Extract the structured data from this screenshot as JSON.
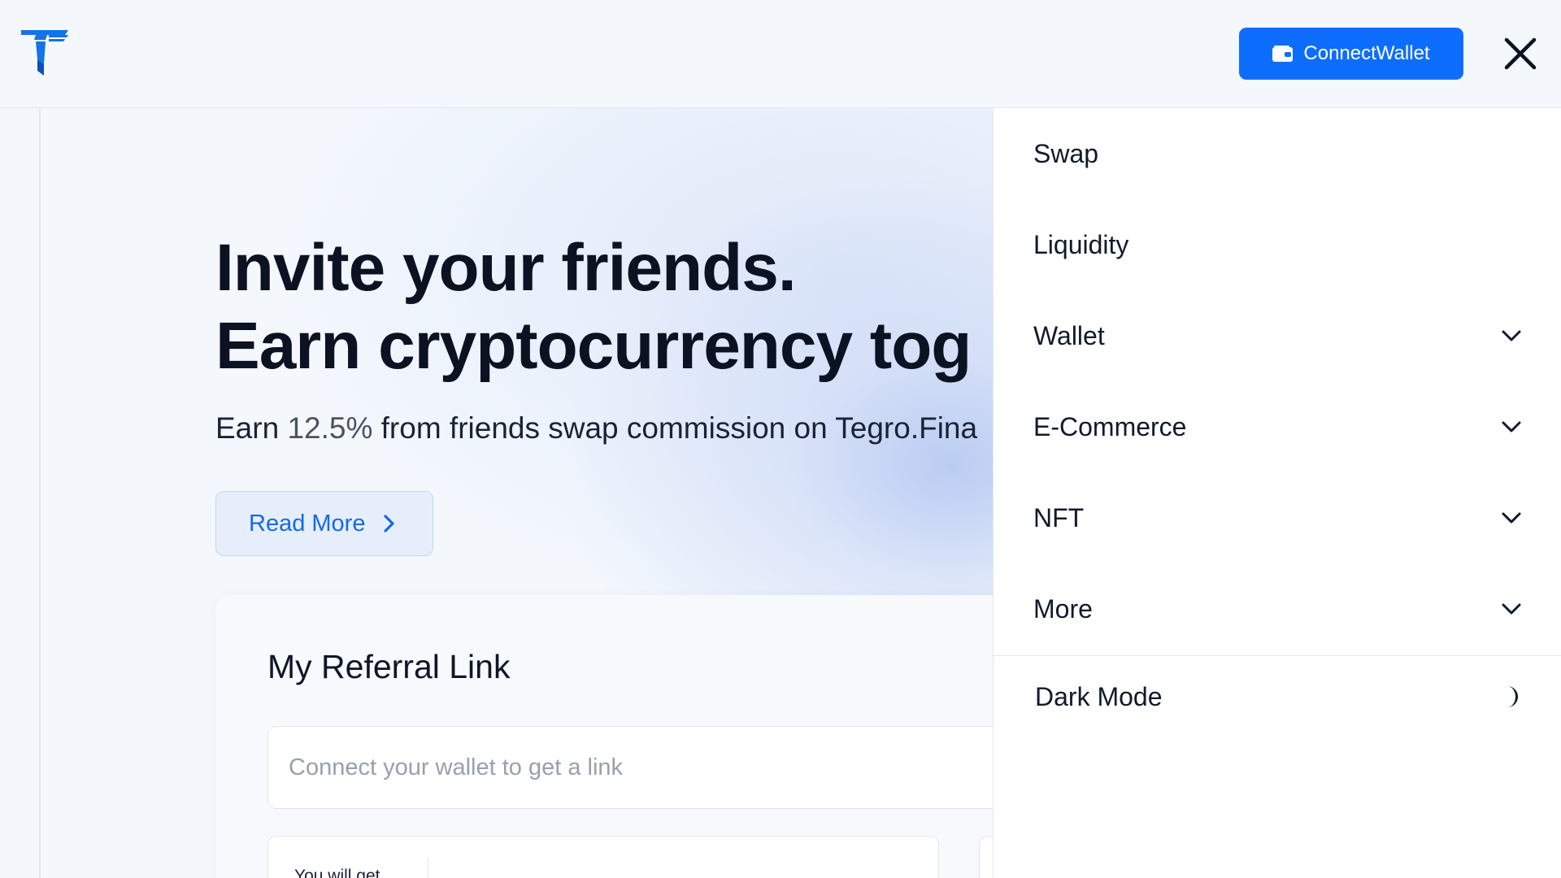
{
  "header": {
    "logo": "tegro-logo",
    "connect_wallet_label": "ConnectWallet",
    "connect_wallet_icon": "wallet-icon",
    "close_icon": "close-icon",
    "accent_color": "#0d6efd"
  },
  "hero": {
    "title_line1": "Invite your friends.",
    "title_line2": "Earn cryptocurrency tog",
    "subtitle_prefix": "Earn ",
    "subtitle_percent": "12.5%",
    "subtitle_suffix": " from friends swap commission on Tegro.Fina",
    "read_more_label": "Read More",
    "read_more_icon": "chevron-right-icon"
  },
  "referral": {
    "title": "My Referral Link",
    "input_placeholder": "Connect your wallet to get a link",
    "you_will_get_label": "You will get"
  },
  "drawer": {
    "items": [
      {
        "label": "Swap",
        "has_dropdown": false
      },
      {
        "label": "Liquidity",
        "has_dropdown": false
      },
      {
        "label": "Wallet",
        "has_dropdown": true
      },
      {
        "label": "E-Commerce",
        "has_dropdown": true
      },
      {
        "label": "NFT",
        "has_dropdown": true
      },
      {
        "label": "More",
        "has_dropdown": true
      }
    ],
    "dark_mode_label": "Dark Mode",
    "dark_mode_icon": "moon-icon"
  }
}
